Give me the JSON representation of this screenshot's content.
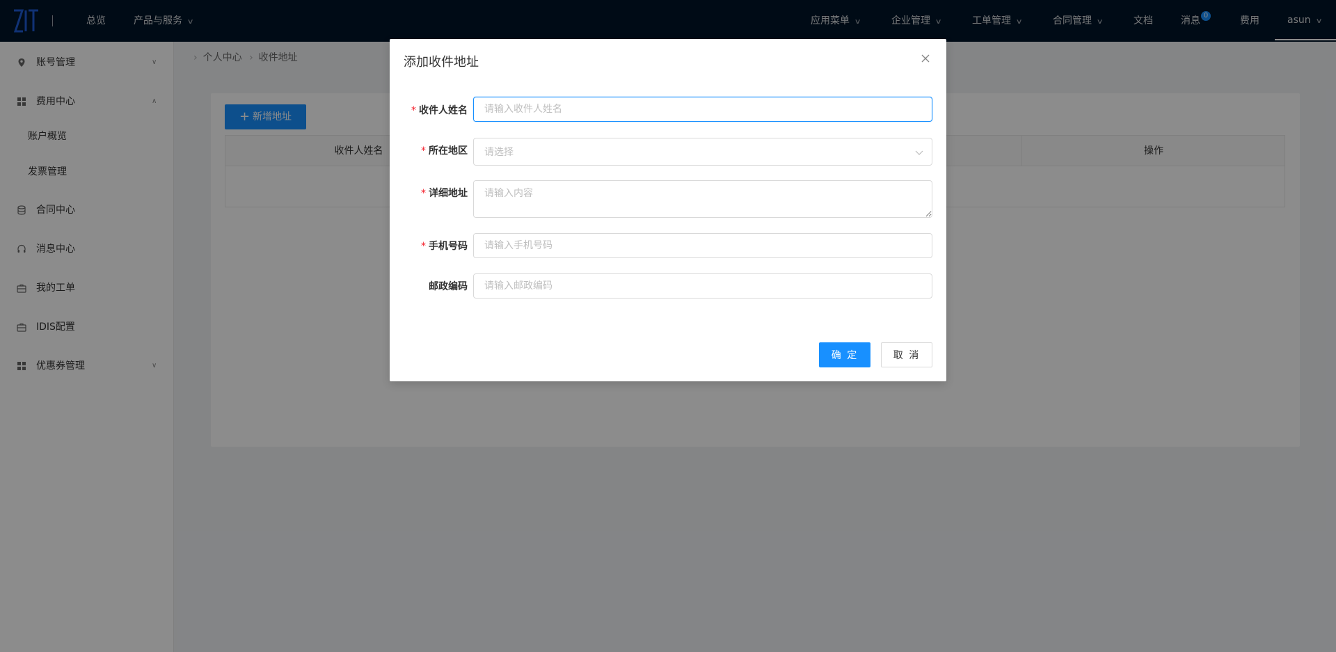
{
  "colors": {
    "topbar_bg": "#001529",
    "primary": "#1890ff",
    "required": "#f5222d"
  },
  "header": {
    "logo_icon": "zit-logo-icon",
    "nav_left": [
      "总览",
      "产品与服务"
    ],
    "nav_right": {
      "app_menu": "应用菜单",
      "enterprise": "企业管理",
      "tickets": "工单管理",
      "contracts": "合同管理",
      "docs": "文档",
      "messages": "消息",
      "messages_badge": "0",
      "fees": "费用",
      "user": "asun"
    }
  },
  "sidebar": {
    "account": {
      "label": "账号管理",
      "icon": "location-pin-icon"
    },
    "fees": {
      "label": "费用中心",
      "icon": "grid-icon"
    },
    "fees_sub": [
      "账户概览",
      "发票管理"
    ],
    "contract": {
      "label": "合同中心",
      "icon": "database-icon"
    },
    "message": {
      "label": "消息中心",
      "icon": "headset-icon"
    },
    "ticket": {
      "label": "我的工单",
      "icon": "briefcase-icon"
    },
    "idis": {
      "label": "IDIS配置",
      "icon": "briefcase-icon"
    },
    "coupon": {
      "label": "优惠券管理",
      "icon": "grid-icon"
    }
  },
  "breadcrumb": {
    "home": "个人中心",
    "current": "收件地址"
  },
  "main": {
    "add_button": "新增地址",
    "columns": {
      "name": "收件人姓名",
      "actions": "操作"
    }
  },
  "modal": {
    "title": "添加收件地址",
    "fields": {
      "name": {
        "label": "收件人姓名",
        "placeholder": "请输入收件人姓名",
        "value": ""
      },
      "region": {
        "label": "所在地区",
        "placeholder": "请选择"
      },
      "address": {
        "label": "详细地址",
        "placeholder": "请输入内容"
      },
      "phone": {
        "label": "手机号码",
        "placeholder": "请输入手机号码"
      },
      "zip": {
        "label": "邮政编码",
        "placeholder": "请输入邮政编码"
      }
    },
    "ok_button": "确 定",
    "cancel_button": "取 消"
  }
}
